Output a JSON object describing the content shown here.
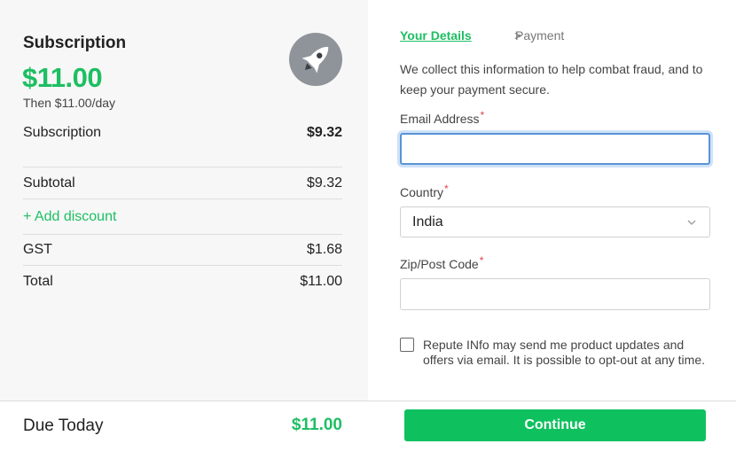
{
  "summary": {
    "title": "Subscription",
    "price": "$11.00",
    "recurrence": "Then $11.00/day",
    "icon": "rocket-icon",
    "lines": [
      {
        "label": "Subscription",
        "value": "$9.32"
      },
      {
        "label": "Subtotal",
        "value": "$9.32"
      },
      {
        "label": "GST",
        "value": "$1.68"
      },
      {
        "label": "Total",
        "value": "$11.00"
      }
    ],
    "add_discount": "+ Add discount"
  },
  "steps": {
    "current": "Your Details",
    "separator": ">",
    "next": "Payment"
  },
  "form": {
    "info": "We collect this information to help combat fraud, and to keep your payment secure.",
    "required_mark": "*",
    "email_label": "Email Address",
    "email_value": "",
    "country_label": "Country",
    "country_value": "India",
    "zip_label": "Zip/Post Code",
    "zip_value": "",
    "consent_text": "Repute INfo may send me product updates and offers via email. It is possible to opt-out at any time."
  },
  "footer": {
    "due_label": "Due Today",
    "due_value": "$11.00",
    "continue_label": "Continue"
  },
  "colors": {
    "accent": "#1dbf62",
    "button": "#0ec15e",
    "required": "#e0424b",
    "focus": "#5a93d6"
  }
}
